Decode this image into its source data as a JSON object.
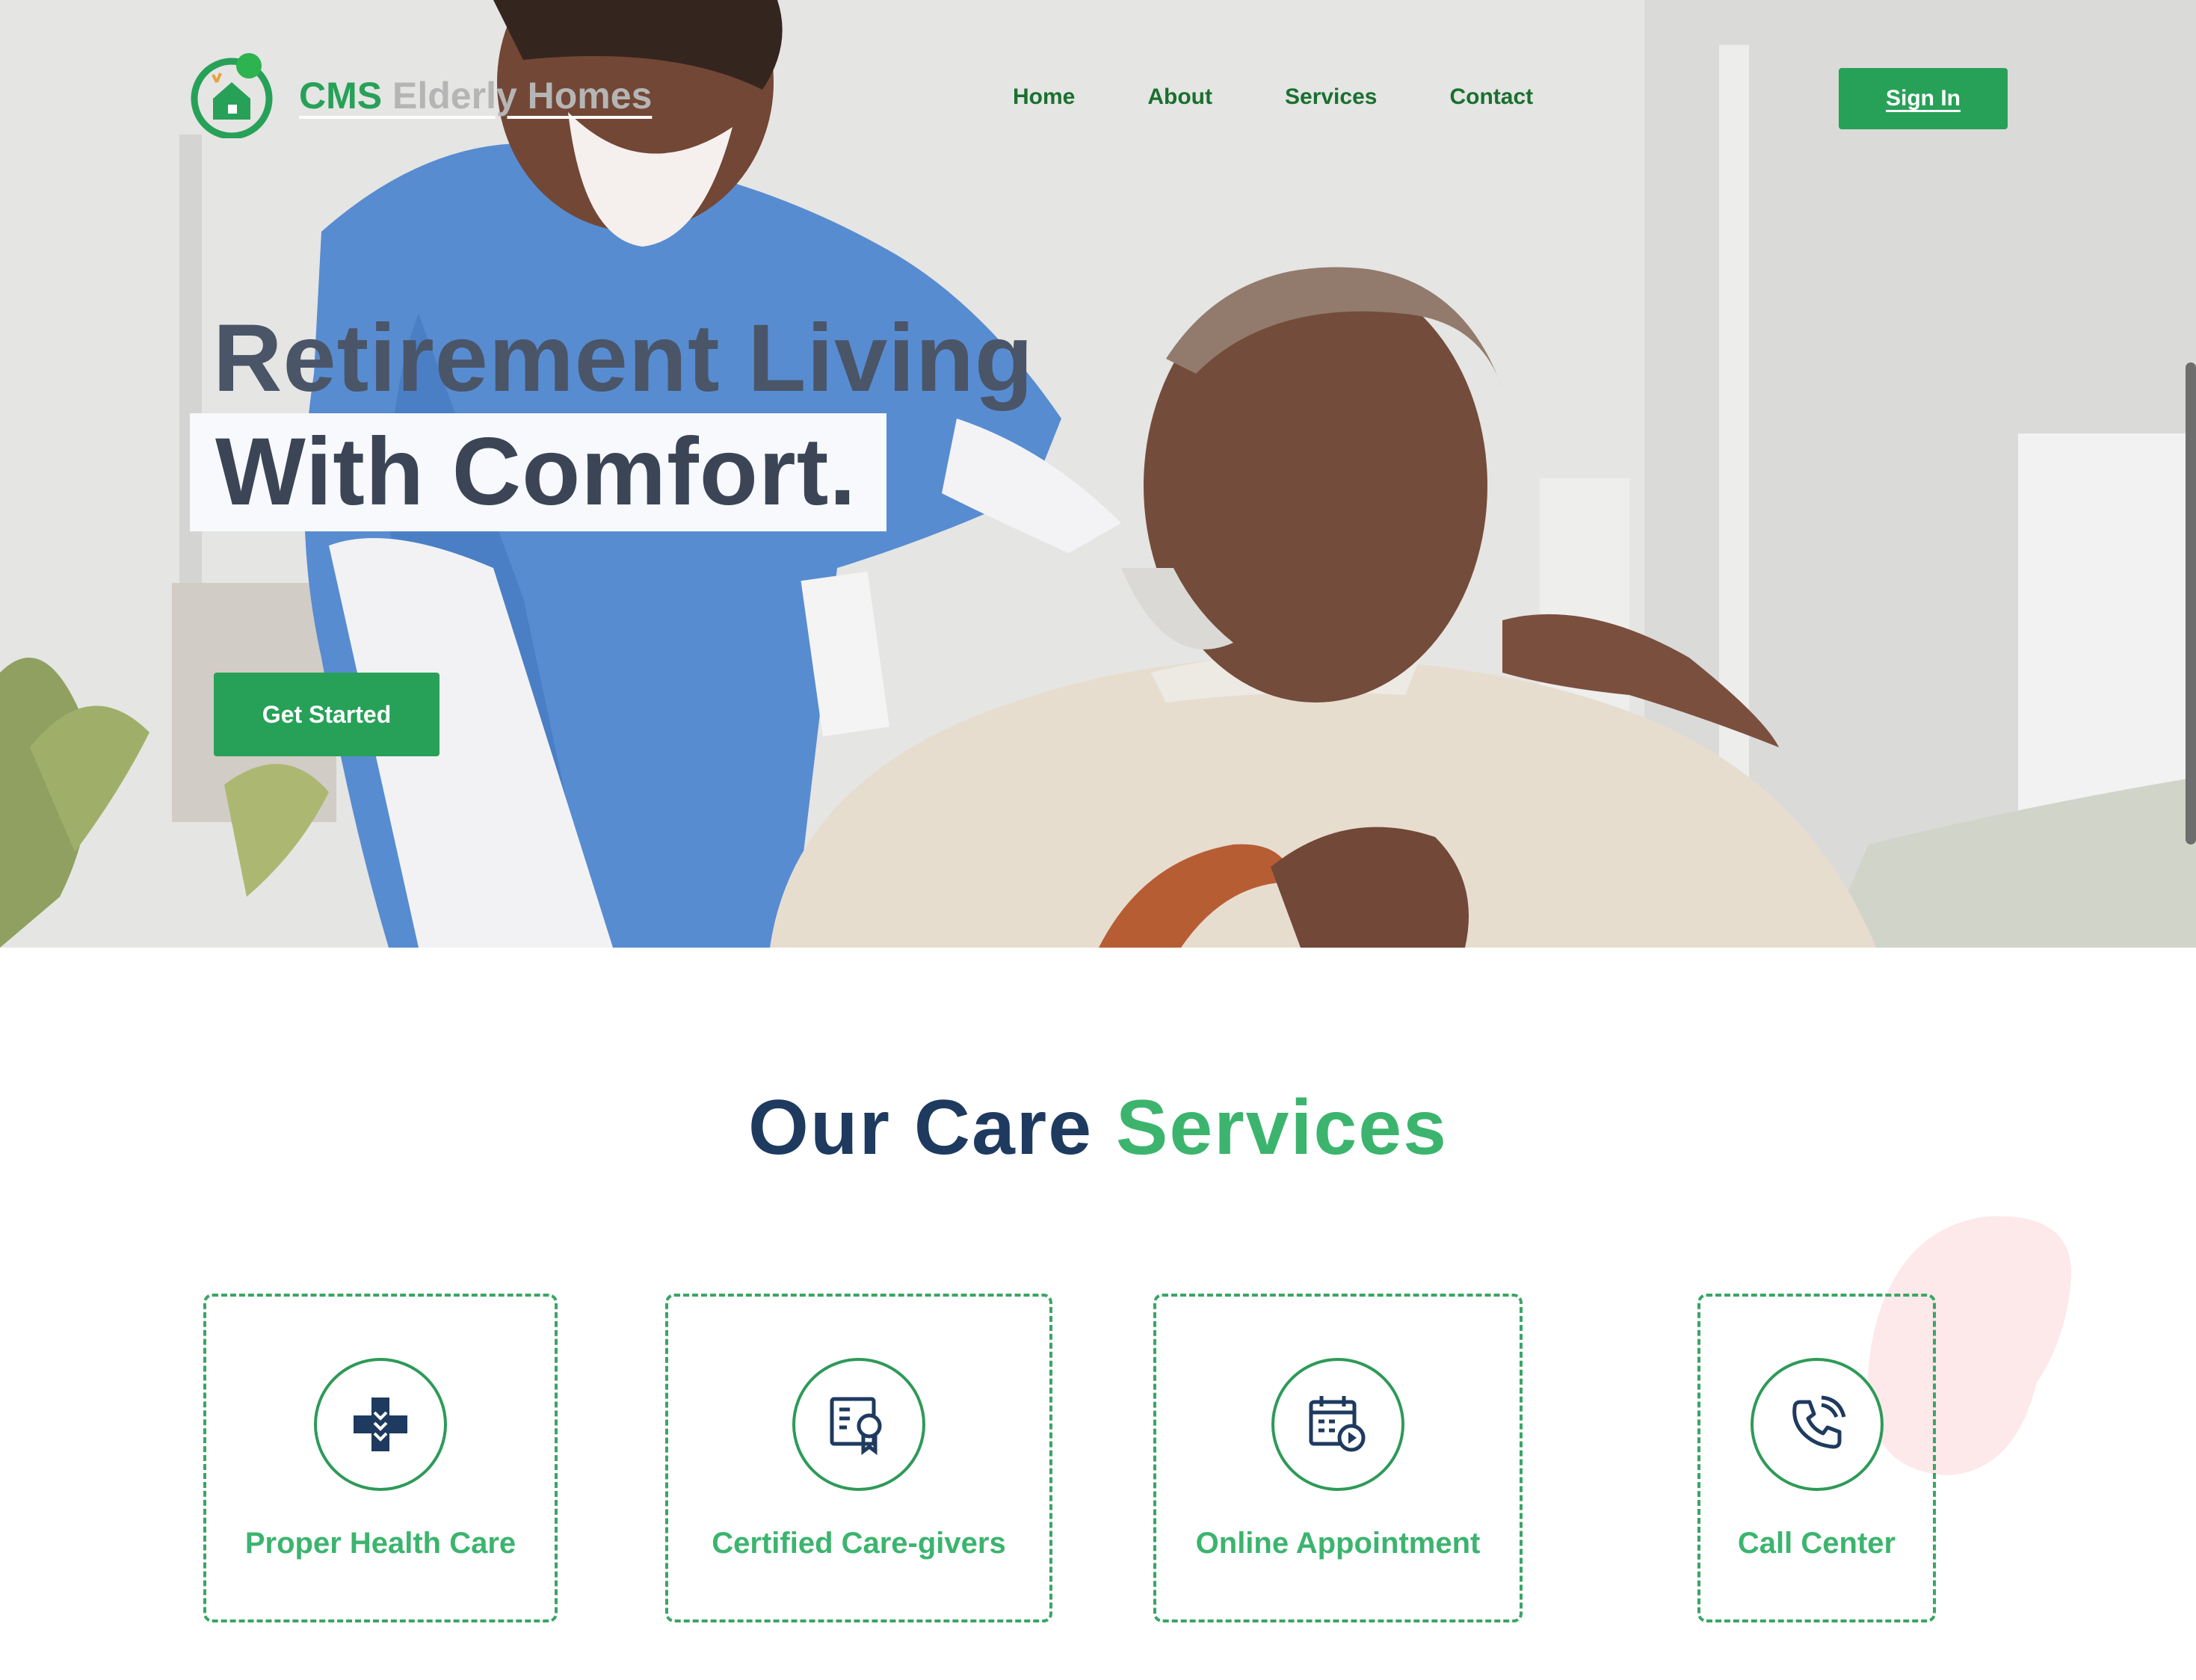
{
  "brand": {
    "name_part1": "CMS",
    "name_part2": "Elderly Homes"
  },
  "nav": {
    "items": [
      "Home",
      "About",
      "Services",
      "Contact"
    ],
    "signin_label": "Sign In"
  },
  "hero": {
    "title_line1": "Retirement Living",
    "title_line2": "With Comfort.",
    "cta_label": "Get Started"
  },
  "services": {
    "title_part1": "Our Care",
    "title_part2": "Services",
    "cards": [
      {
        "label": "Proper Health Care",
        "icon": "medical-cross-icon"
      },
      {
        "label": "Certified Care-givers",
        "icon": "certificate-icon"
      },
      {
        "label": "Online Appointment",
        "icon": "calendar-appointment-icon"
      },
      {
        "label": "Call Center",
        "icon": "phone-icon"
      }
    ]
  },
  "colors": {
    "primary": "#27a158",
    "accent_green": "#3cb46e",
    "navy": "#1e3a5f",
    "hero_title": "#4a5568"
  }
}
